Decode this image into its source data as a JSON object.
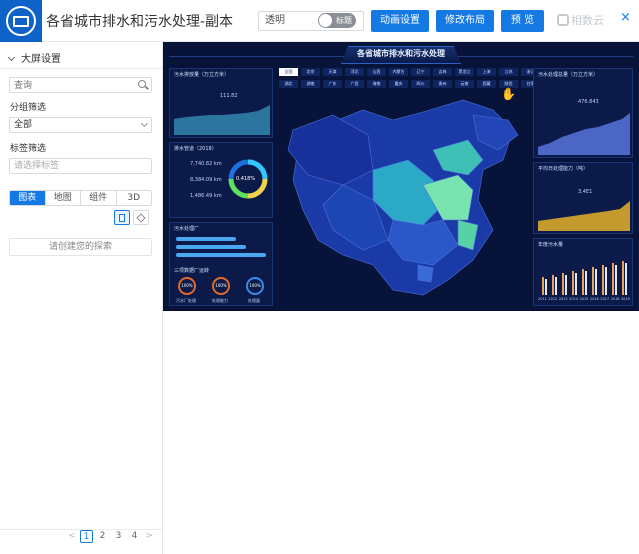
{
  "header": {
    "title": "各省城市排水和污水处理-副本",
    "transparent_label": "透明",
    "toggle_text": "标题",
    "animation_button": "动画设置",
    "layout_button": "修改布局",
    "preview_button": "预 览",
    "brand": "相数云",
    "close": "×"
  },
  "sidebar": {
    "title": "大屏设置",
    "search_placeholder": "查询",
    "group_filter_label": "分组筛选",
    "group_filter_value": "全部",
    "tag_filter_label": "标签筛选",
    "tag_placeholder": "请选择标签",
    "tabs": [
      "图表",
      "地图",
      "组件",
      "3D"
    ],
    "active_tab": "图表",
    "custom_explore": "请创建您的探索",
    "pager": {
      "prev": "<",
      "pages": [
        "1",
        "2",
        "3",
        "4"
      ],
      "current": "1",
      "next": ">"
    }
  },
  "dashboard": {
    "title": "各省城市排水和污水处理",
    "panels": {
      "drainage_length": "污水排放量（万立方米）",
      "drainage_value": "111.82",
      "drainage_pipe": "排水管道（2018）",
      "stats": [
        "7,740.82 km",
        "8,384.09 km",
        "1,486.49 km"
      ],
      "ring_value": "0.418%",
      "treatment_plants": "污水处理厂",
      "plant_ops": "三项数据厂运转",
      "gauges": [
        {
          "value": "100%",
          "label": "污水厂处理"
        },
        {
          "value": "100%",
          "label": "处理能力"
        },
        {
          "value": "100%",
          "label": "处理量"
        }
      ],
      "treatment_volume": "污水处理总量（万立方米）",
      "treatment_value": "476.843",
      "daily_capacity": "平均日处理能力（吨）",
      "daily_value": "3.4E1",
      "yearly_chart": "年度污水量",
      "years": [
        "2011",
        "2012",
        "2013",
        "2014",
        "2015",
        "2016",
        "2017",
        "2018",
        "2019"
      ]
    },
    "provinces_row1": [
      "全国",
      "北京",
      "天津",
      "河北",
      "山西",
      "内蒙古",
      "辽宁",
      "吉林",
      "黑龙江",
      "上海",
      "江苏",
      "浙江",
      "安徽",
      "福建",
      "江西",
      "山东",
      "河南"
    ],
    "provinces_row2": [
      "湖北",
      "湖南",
      "广东",
      "广西",
      "海南",
      "重庆",
      "四川",
      "贵州",
      "云南",
      "西藏",
      "陕西",
      "甘肃",
      "青海",
      "宁夏",
      "新疆"
    ]
  },
  "colors": {
    "accent": "#1479e3",
    "dashboard_bg": "#08133a",
    "map_fill_dark": "#1a3aa8",
    "map_fill_mid": "#2ba9c7",
    "map_fill_light": "#79e3b0",
    "chart_area": "#4c66c6",
    "chart_gold": "#c49a2e"
  }
}
